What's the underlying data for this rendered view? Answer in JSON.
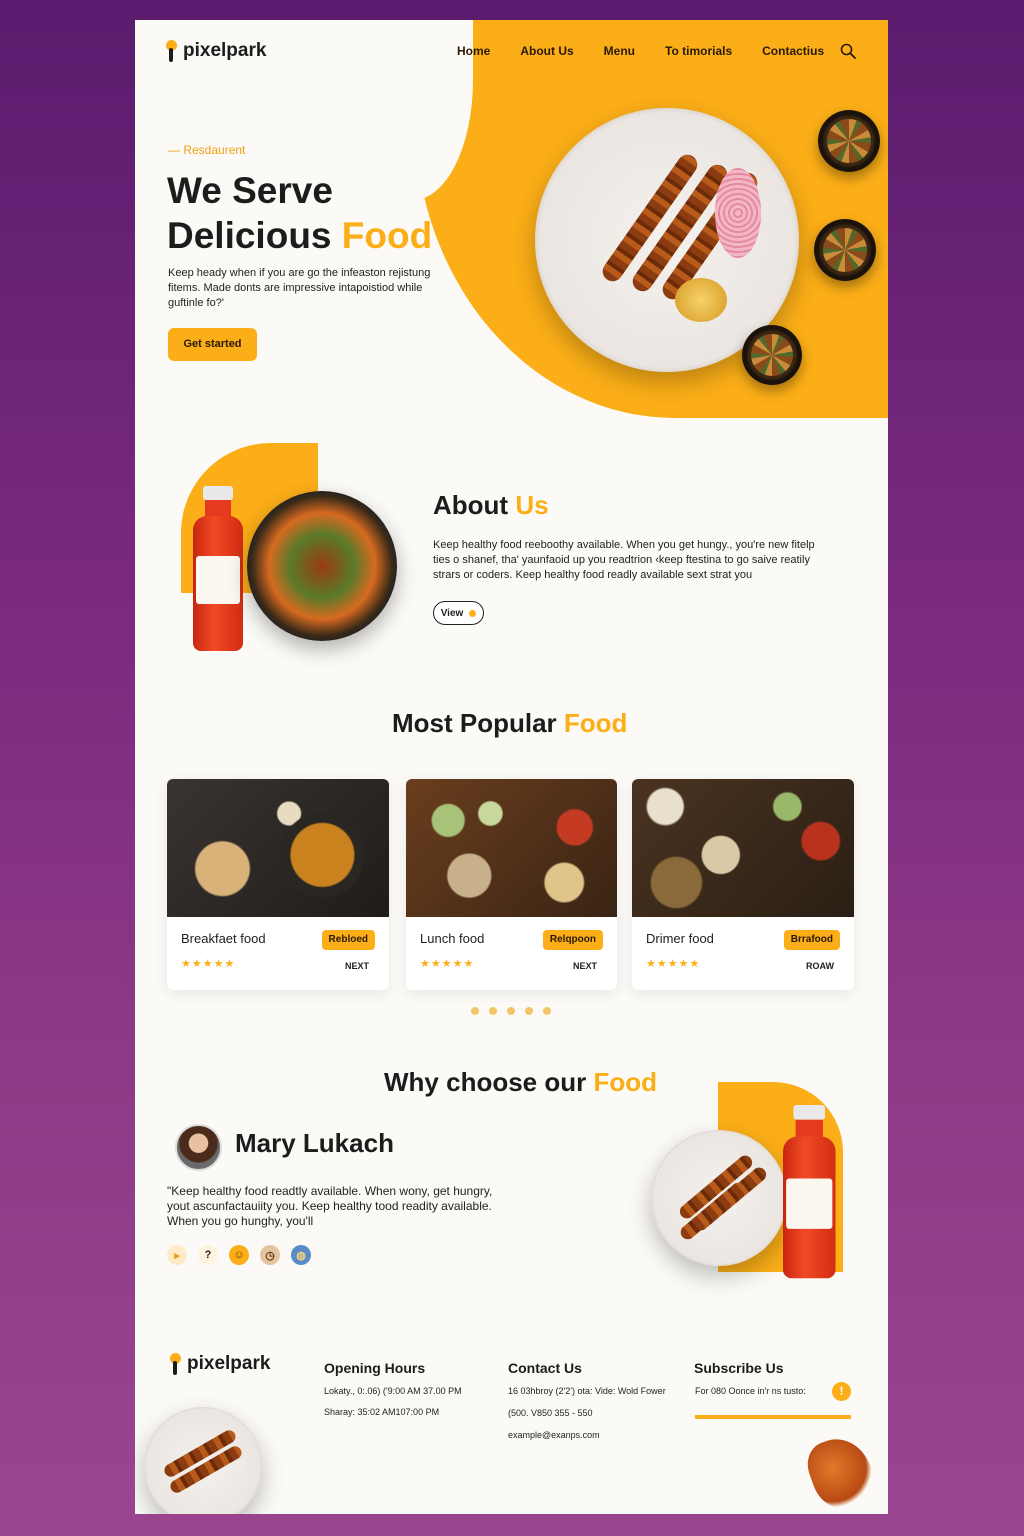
{
  "brand": {
    "name": "pixelpark"
  },
  "nav": {
    "items": [
      "Home",
      "About Us",
      "Menu",
      "To timorials",
      "Contactius"
    ]
  },
  "hero": {
    "eyebrow": "— Resdaurent",
    "title_line1": "We Serve",
    "title_line2_plain": "Delicious ",
    "title_line2_accent": "Food",
    "text": "Keep heady when if you are go the infeaston rejistung fitems. Made donts are impressive intapoistiod while guftinle fo?'",
    "cta": "Get started"
  },
  "about": {
    "title_plain": "About ",
    "title_accent": "Us",
    "text": "Keep healthy food reeboothy available. When you get hungy., you're new fitelp ties o shanef, tha' yaunfaoid up you readtrion ‹keep ftestina to go saive reatily strars or coders. Keep healthy food readly available sext strat you",
    "button": "View"
  },
  "popular": {
    "title_plain": "Most Popular ",
    "title_accent": "Food",
    "cards": [
      {
        "name": "Breakfaet food",
        "tag": "Rebloed",
        "stars": "★★★★★",
        "link": "NEXT"
      },
      {
        "name": "Lunch food",
        "tag": "Relqpoon",
        "stars": "★★★★★",
        "link": "NEXT"
      },
      {
        "name": "Drimer food",
        "tag": "Brrafood",
        "stars": "★★★★★",
        "link": "ROAW"
      }
    ]
  },
  "why": {
    "title_plain": "Why choose our ",
    "title_accent": "Food",
    "person": "Mary Lukach",
    "quote": "\"Keep healthy food readtly available. When wony, get hungry, yout ascunfactauiity you. Keep healthy tood readity available. When you go hunghy, you'll",
    "social_icons": [
      "arrow-icon",
      "question-icon",
      "smile-icon",
      "clock-icon",
      "globe-icon"
    ]
  },
  "footer": {
    "brand": "pixelpark",
    "hours_title": "Opening Hours",
    "hours": [
      "Lokaty., 0:.06) ('9:00 AM 37.00 PM",
      "Sharay: 35:02 AM107:00 PM"
    ],
    "contact_title": "Contact Us",
    "contact": [
      "16 03hbroy (2'2') ota: Vide: Wold Fower",
      "(500. V850 355 - 550",
      "example@exanps.com"
    ],
    "subscribe_title": "Subscribe Us",
    "subscribe_text": "For 080 Oonce in'r ns tusto:"
  },
  "colors": {
    "accent": "#fbae17",
    "text": "#1c1c1c",
    "page": "#fcfaf6"
  }
}
